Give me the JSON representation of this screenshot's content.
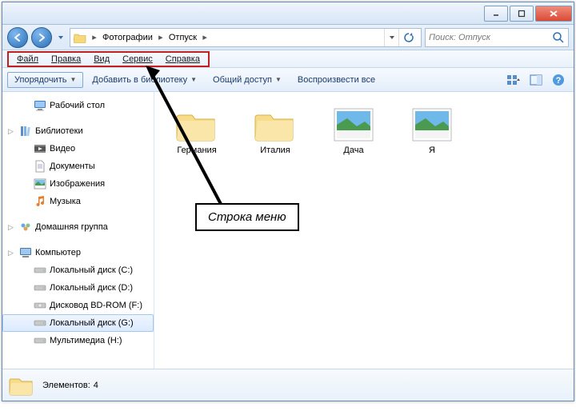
{
  "titlebar": {
    "minimize": "—",
    "maximize": "□",
    "close": "✕"
  },
  "nav": {
    "back": "back",
    "forward": "forward"
  },
  "address": {
    "crumbs": [
      "Фотографии",
      "Отпуск"
    ]
  },
  "search": {
    "placeholder": "Поиск: Отпуск"
  },
  "menubar": {
    "items": [
      "Файл",
      "Правка",
      "Вид",
      "Сервис",
      "Справка"
    ]
  },
  "toolbar": {
    "organize": "Упорядочить",
    "addlib": "Добавить в библиотеку",
    "share": "Общий доступ",
    "play": "Воспроизвести все"
  },
  "sidebar": {
    "desktop": "Рабочий стол",
    "libraries": "Библиотеки",
    "videos": "Видео",
    "documents": "Документы",
    "pictures": "Изображения",
    "music": "Музыка",
    "homegroup": "Домашняя группа",
    "computer": "Компьютер",
    "diskC": "Локальный диск (C:)",
    "diskD": "Локальный диск (D:)",
    "bdrom": "Дисковод BD-ROM (F:)",
    "diskG": "Локальный диск (G:)",
    "multimedia": "Мультимедиа (H:)"
  },
  "files": {
    "items": [
      "Германия",
      "Италия",
      "Дача",
      "Я"
    ]
  },
  "status": {
    "label": "Элементов:",
    "count": "4"
  },
  "annotation": {
    "label": "Строка меню"
  }
}
